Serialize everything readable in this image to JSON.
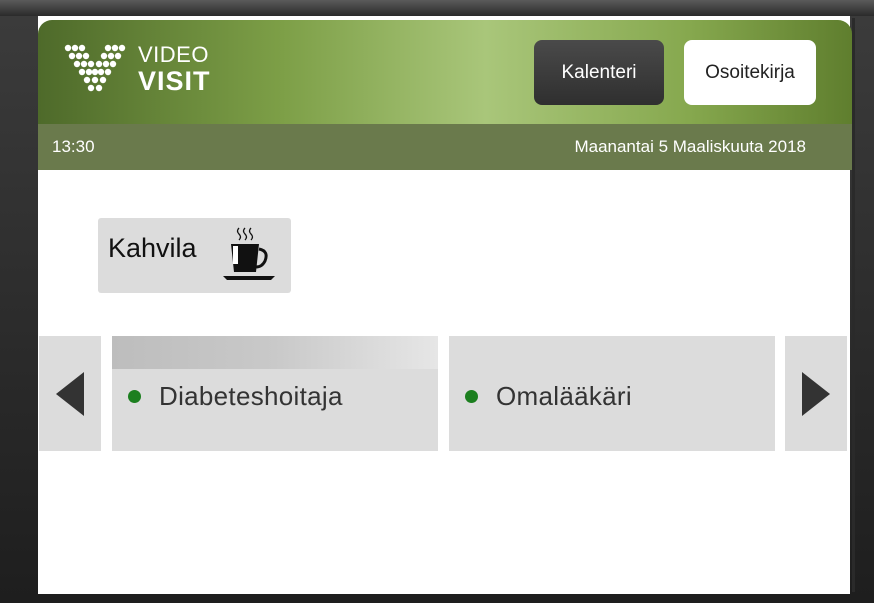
{
  "logo": {
    "line1": "VIDEO",
    "line2": "VISIT"
  },
  "header": {
    "buttons": [
      {
        "label": "Kalenteri"
      },
      {
        "label": "Osoitekirja"
      }
    ]
  },
  "status": {
    "time": "13:30",
    "date": "Maanantai 5 Maaliskuuta 2018"
  },
  "cafe": {
    "label": "Kahvila",
    "icon": "coffee-cup-icon"
  },
  "contacts": [
    {
      "name": "Diabeteshoitaja",
      "status_color": "#1c7f1f"
    },
    {
      "name": "Omalääkäri",
      "status_color": "#1c7f1f"
    }
  ],
  "colors": {
    "header_green": "#86a84e",
    "status_bar": "#6a7a4c",
    "online": "#1c7f1f",
    "tile_gray": "#dcdcdc"
  }
}
